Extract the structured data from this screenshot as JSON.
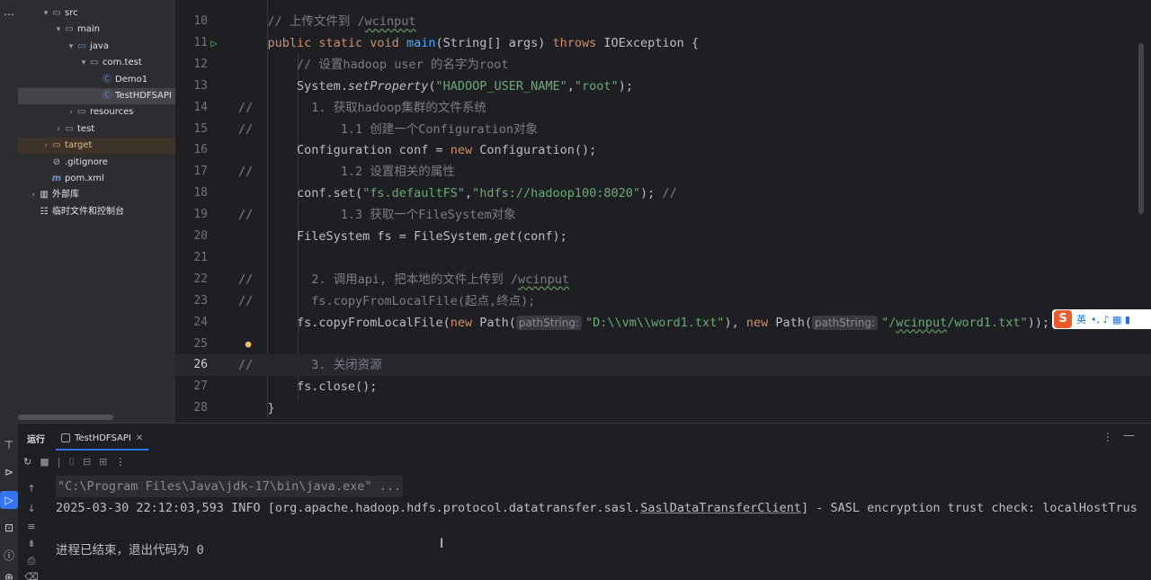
{
  "project_tree": [
    {
      "chevron": "▾",
      "icon": "folder",
      "label": "src",
      "indent": 1
    },
    {
      "chevron": "▾",
      "icon": "folder",
      "label": "main",
      "indent": 2
    },
    {
      "chevron": "▾",
      "icon": "folder-src",
      "label": "java",
      "indent": 3
    },
    {
      "chevron": "▾",
      "icon": "folder",
      "label": "com.test",
      "indent": 4
    },
    {
      "chevron": "",
      "icon": "class",
      "label": "Demo1",
      "indent": 5
    },
    {
      "chevron": "",
      "icon": "class",
      "label": "TestHDFSAPI",
      "indent": 5,
      "selected": true
    },
    {
      "chevron": "›",
      "icon": "folder",
      "label": "resources",
      "indent": 3
    },
    {
      "chevron": "›",
      "icon": "folder",
      "label": "test",
      "indent": 2
    },
    {
      "chevron": "›",
      "icon": "folder-target",
      "label": "target",
      "indent": 1,
      "highlight": "target"
    },
    {
      "chevron": "",
      "icon": "git",
      "label": ".gitignore",
      "indent": 1
    },
    {
      "chevron": "",
      "icon": "maven",
      "label": "pom.xml",
      "indent": 1
    },
    {
      "chevron": "›",
      "icon": "library",
      "label": "外部库",
      "indent": 0
    },
    {
      "chevron": "",
      "icon": "scratch",
      "label": "临时文件和控制台",
      "indent": 0
    }
  ],
  "editor": {
    "lines": [
      {
        "n": "10",
        "segs": [
          [
            "cm",
            "    // 上传文件到 /"
          ],
          [
            "cm under",
            "wcinput"
          ]
        ]
      },
      {
        "n": "11",
        "run": true,
        "segs": [
          [
            "kw",
            "    public static void "
          ],
          [
            "fn",
            "main"
          ],
          [
            "",
            "(String[] args) "
          ],
          [
            "kw",
            "throws "
          ],
          [
            "",
            "IOException {"
          ]
        ]
      },
      {
        "n": "12",
        "segs": [
          [
            "cm",
            "        // 设置hadoop user 的名字为root"
          ]
        ]
      },
      {
        "n": "13",
        "segs": [
          [
            "",
            "        System."
          ],
          [
            "it",
            "setProperty"
          ],
          [
            "",
            "("
          ],
          [
            "str",
            "\"HADOOP_USER_NAME\""
          ],
          [
            "",
            ","
          ],
          [
            "str",
            "\"root\""
          ],
          [
            "",
            ");"
          ]
        ]
      },
      {
        "n": "14",
        "segs": [
          [
            "cm",
            "//        1. 获取hadoop集群的文件系统"
          ]
        ]
      },
      {
        "n": "15",
        "segs": [
          [
            "cm",
            "//            1.1 创建一个Configuration对象"
          ]
        ]
      },
      {
        "n": "16",
        "segs": [
          [
            "",
            "        Configuration conf = "
          ],
          [
            "kw",
            "new "
          ],
          [
            "",
            "Configuration();"
          ]
        ]
      },
      {
        "n": "17",
        "segs": [
          [
            "cm",
            "//            1.2 设置相关的属性"
          ]
        ]
      },
      {
        "n": "18",
        "segs": [
          [
            "",
            "        conf.set("
          ],
          [
            "str",
            "\"fs.defaultFS\""
          ],
          [
            "",
            ","
          ],
          [
            "str",
            "\"hdfs://hadoop100:8020\""
          ],
          [
            "",
            "); "
          ],
          [
            "cm",
            "//"
          ]
        ]
      },
      {
        "n": "19",
        "segs": [
          [
            "cm",
            "//            1.3 获取一个FileSystem对象"
          ]
        ]
      },
      {
        "n": "20",
        "segs": [
          [
            "",
            "        FileSystem fs = FileSystem."
          ],
          [
            "it",
            "get"
          ],
          [
            "",
            "(conf);"
          ]
        ]
      },
      {
        "n": "21",
        "segs": []
      },
      {
        "n": "22",
        "segs": [
          [
            "cm",
            "//        2. 调用api, 把本地的文件上传到 /"
          ],
          [
            "cm under",
            "wcinput"
          ]
        ]
      },
      {
        "n": "23",
        "segs": [
          [
            "cm",
            "//        fs.copyFromLocalFile(起点,终点);"
          ]
        ]
      },
      {
        "n": "24",
        "segs": [
          [
            "",
            "        fs.copyFromLocalFile("
          ],
          [
            "kw",
            "new "
          ],
          [
            "",
            "Path("
          ],
          [
            "hint",
            "pathString:"
          ],
          [
            "str",
            "\"D:\\\\vm\\\\word1.txt\""
          ],
          [
            "",
            "), "
          ],
          [
            "kw",
            "new "
          ],
          [
            "",
            "Path("
          ],
          [
            "hint",
            "pathString:"
          ],
          [
            "str",
            "\"/"
          ],
          [
            "str under",
            "wcinput"
          ],
          [
            "str",
            "/word1.txt\""
          ],
          [
            "",
            "));"
          ]
        ]
      },
      {
        "n": "25",
        "bulb": true,
        "segs": []
      },
      {
        "n": "26",
        "current": true,
        "segs": [
          [
            "cm",
            "//        3. 关闭资源"
          ]
        ]
      },
      {
        "n": "27",
        "segs": [
          [
            "",
            "        fs.close();"
          ]
        ]
      },
      {
        "n": "28",
        "segs": [
          [
            "",
            "    }"
          ]
        ]
      }
    ]
  },
  "ime": {
    "logo": "S",
    "lang": "英",
    "icons": "•, ♪ ▦ ▮"
  },
  "run_panel": {
    "title": "运行",
    "tab_label": "TestHDFSAPI",
    "console": [
      {
        "type": "cmd",
        "text": "\"C:\\Program Files\\Java\\jdk-17\\bin\\java.exe\" ..."
      },
      {
        "type": "log",
        "pre": "2025-03-30 22:12:03,593 INFO [org.apache.hadoop.hdfs.protocol.datatransfer.sasl.",
        "link": "SaslDataTransferClient",
        "post": "] - SASL encryption trust check: localHostTrus"
      },
      {
        "type": "blank",
        "text": ""
      },
      {
        "type": "exit",
        "text": "进程已结束，退出代码为 0"
      }
    ]
  }
}
